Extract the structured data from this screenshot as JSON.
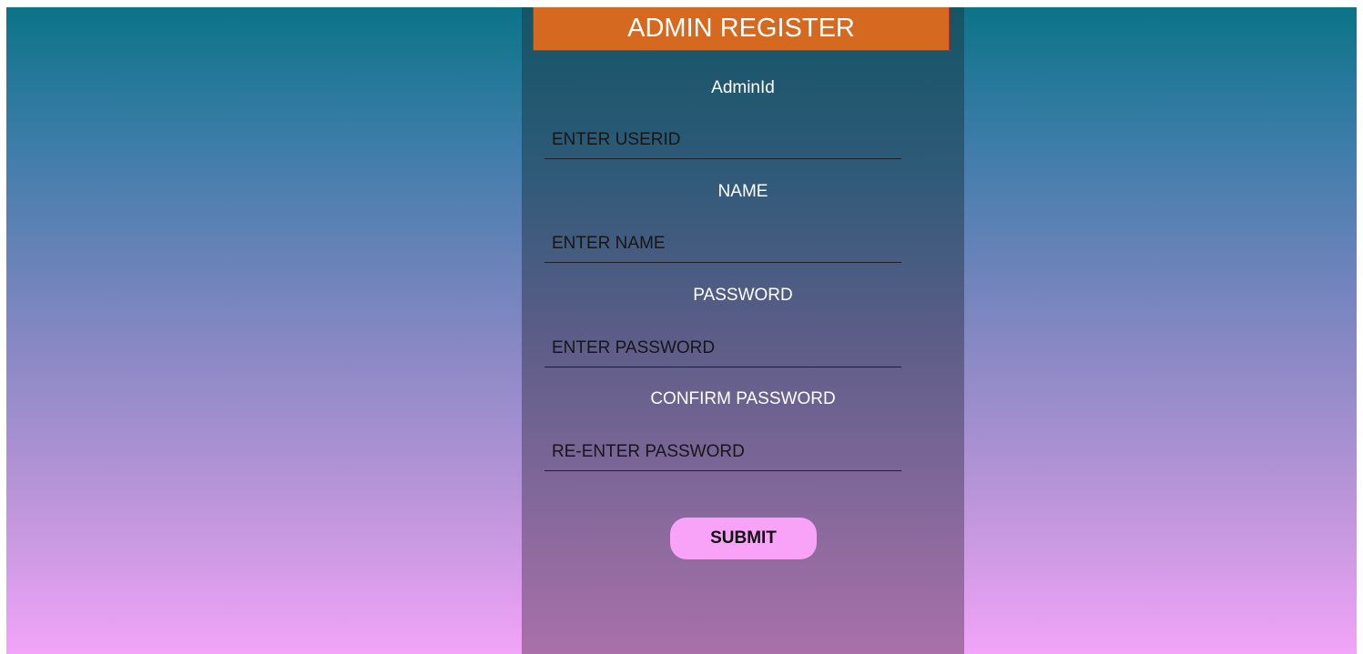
{
  "form": {
    "title": "ADMIN REGISTER",
    "fields": [
      {
        "label": "AdminId",
        "placeholder": "ENTER USERID",
        "value": ""
      },
      {
        "label": "NAME",
        "placeholder": "ENTER NAME",
        "value": ""
      },
      {
        "label": "PASSWORD",
        "placeholder": "ENTER PASSWORD",
        "value": ""
      },
      {
        "label": "CONFIRM PASSWORD",
        "placeholder": "RE-ENTER PASSWORD",
        "value": ""
      }
    ],
    "submit_label": "SUBMIT"
  },
  "colors": {
    "header_bg": "#d5691f",
    "submit_bg": "#f8a3f7"
  }
}
